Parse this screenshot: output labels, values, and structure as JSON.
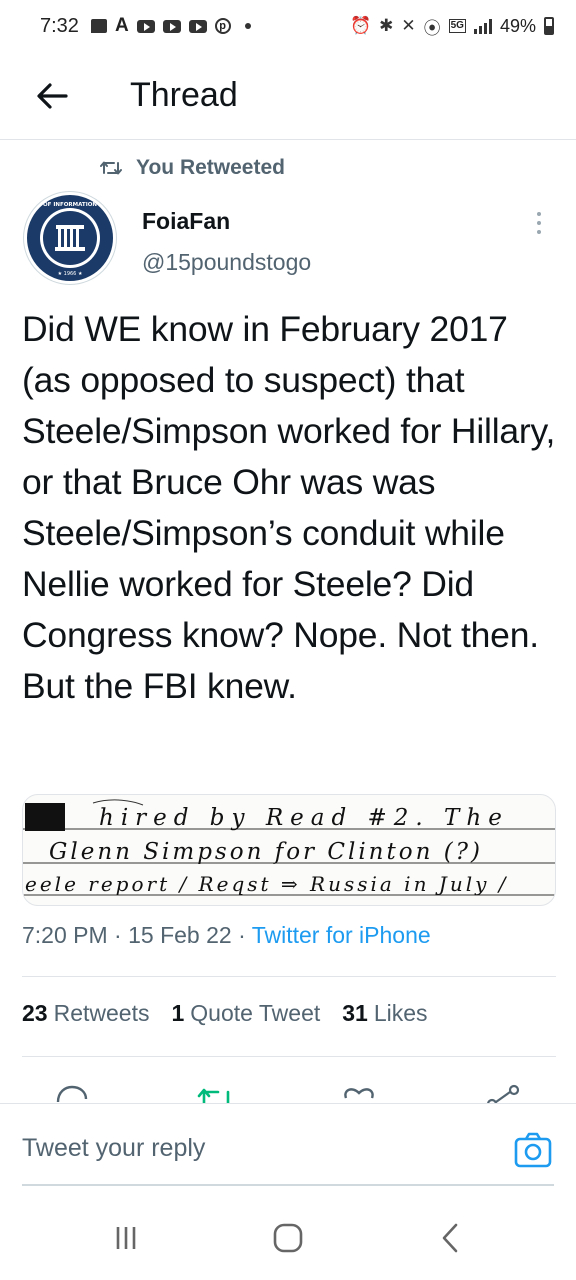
{
  "status_bar": {
    "time": "7:32",
    "network": "5G",
    "battery": "49%"
  },
  "header": {
    "title": "Thread",
    "back_icon": "arrow-left-icon"
  },
  "social_context": {
    "icon": "retweet-icon",
    "label": "You Retweeted"
  },
  "tweet": {
    "author_name": "FoiaFan",
    "author_handle": "@15poundstogo",
    "avatar_text": "FREEDOM OF INFORMATION ACT",
    "text": "Did WE know in February 2017 (as opposed to suspect) that Steele/Simpson worked for Hillary, or that Bruce Ohr was was Steele/Simpson’s conduit while Nellie worked for Steele?  Did Congress know?  Nope. Not then. But the FBI knew.",
    "media_lines": [
      "hired by Read #2. The",
      "Glenn Simpson for Clinton (?)",
      "eele report / Reqst ⇒ Russia in July /"
    ],
    "timestamp": "7:20 PM · 15 Feb 22 · ",
    "source": "Twitter for iPhone",
    "stats": {
      "retweets_count": "23",
      "retweets_label": "Retweets",
      "quotes_count": "1",
      "quotes_label": "Quote Tweet",
      "likes_count": "31",
      "likes_label": "Likes"
    }
  },
  "actions": [
    "reply-icon",
    "retweet-icon",
    "like-icon",
    "share-icon"
  ],
  "reply_bar": {
    "placeholder": "Tweet your reply",
    "camera_icon": "camera-icon"
  },
  "nav_bar": [
    "recent-apps-icon",
    "home-icon",
    "back-icon"
  ],
  "colors": {
    "accent": "#1d9bf0",
    "retweet_green": "#00ba7c",
    "secondary_text": "#536471",
    "primary_text": "#0f1419"
  }
}
